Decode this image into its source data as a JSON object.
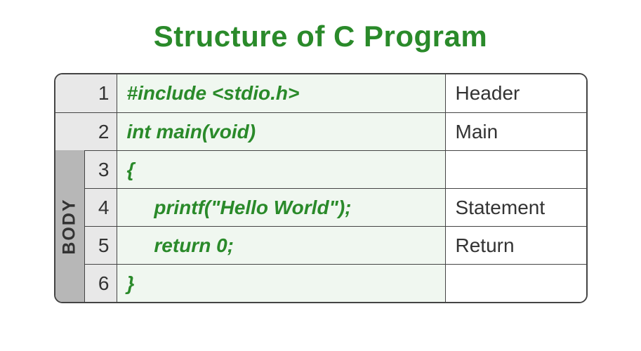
{
  "title": "Structure of C Program",
  "body_label": "BODY",
  "rows": [
    {
      "n": "1",
      "code": "#include <stdio.h>",
      "label": "Header"
    },
    {
      "n": "2",
      "code": "int main(void)",
      "label": "Main"
    },
    {
      "n": "3",
      "code": "{",
      "label": ""
    },
    {
      "n": "4",
      "code": "     printf(\"Hello World\");",
      "label": "Statement"
    },
    {
      "n": "5",
      "code": "     return 0;",
      "label": "Return"
    },
    {
      "n": "6",
      "code": "}",
      "label": ""
    }
  ]
}
